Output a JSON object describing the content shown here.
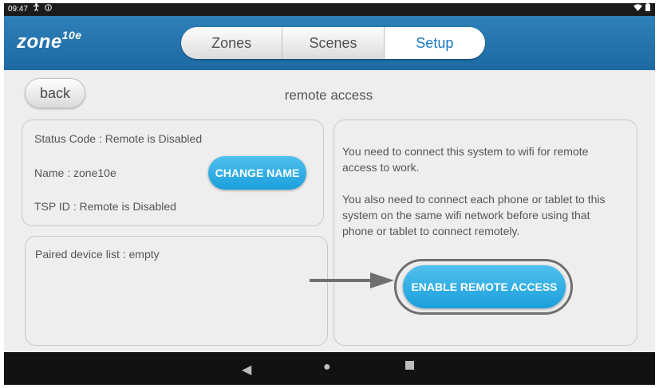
{
  "statusbar": {
    "time": "09:47",
    "left_icons": [
      "accessibility-icon",
      "info-icon"
    ],
    "right_icons": [
      "wifi-icon",
      "battery-icon"
    ]
  },
  "app": {
    "logo_text": "zone",
    "logo_sup": "10e"
  },
  "tabs": [
    {
      "label": "Zones",
      "active": false
    },
    {
      "label": "Scenes",
      "active": false
    },
    {
      "label": "Setup",
      "active": true
    }
  ],
  "header": {
    "back_label": "back",
    "title": "remote access"
  },
  "status_panel": {
    "status_code": "Status Code : Remote is Disabled",
    "name": "Name : zone10e",
    "tsp_id": "TSP ID : Remote is Disabled",
    "change_name_label": "CHANGE NAME"
  },
  "paired_panel": {
    "label": "Paired device list : empty"
  },
  "info_panel": {
    "text1": "You need to connect this system to wifi for remote access to work.",
    "text2": "You also need to connect each phone or tablet to this system on the same wifi network before using that phone or tablet to connect remotely.",
    "enable_label": "ENABLE REMOTE ACCESS"
  },
  "navbar": {
    "icons": [
      "nav-back-icon",
      "nav-home-icon",
      "nav-recents-icon"
    ]
  },
  "colors": {
    "appbar": "#1d6aa3",
    "active_tab_text": "#1a78c2",
    "button_blue": "#1b9fdc",
    "highlight_ring": "#6f6f72"
  }
}
